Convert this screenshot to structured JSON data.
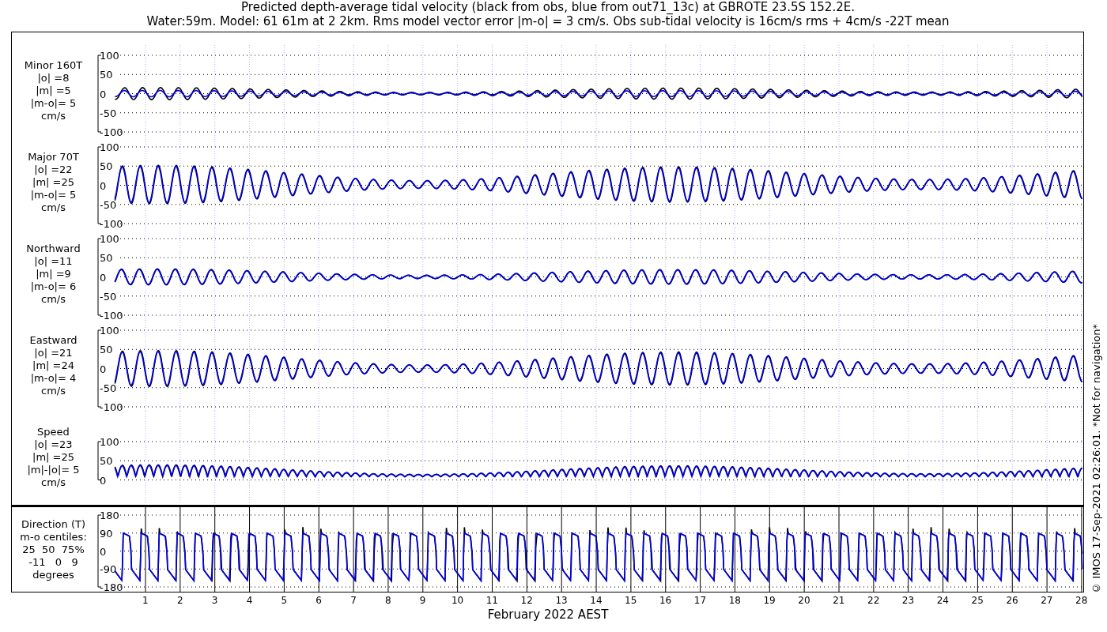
{
  "title_lines": [
    "Predicted depth-average tidal velocity (black from obs, blue from out71_13c) at GBROTE 23.5S 152.2E.",
    "Water:59m. Model: 61 61m at 2 2km. Rms model vector error |m-o| = 3 cm/s. Obs sub-tidal velocity is 16cm/s rms + 4cm/s -22T mean"
  ],
  "panels": [
    {
      "kind": "minor",
      "label_lines": [
        "Minor 160T",
        "|o| =8",
        "|m| =5",
        "|m-o|= 5",
        "cm/s"
      ],
      "yticks": [
        "100",
        "50",
        "0",
        "-50",
        "-100"
      ]
    },
    {
      "kind": "major",
      "label_lines": [
        "Major 70T",
        "|o| =22",
        "|m| =25",
        "|m-o|= 5",
        "cm/s"
      ],
      "yticks": [
        "100",
        "50",
        "0",
        "-50",
        "-100"
      ]
    },
    {
      "kind": "north",
      "label_lines": [
        "Northward",
        "|o| =11",
        "|m| =9",
        "|m-o|= 6",
        "cm/s"
      ],
      "yticks": [
        "100",
        "50",
        "0",
        "-50",
        "-100"
      ]
    },
    {
      "kind": "east",
      "label_lines": [
        "Eastward",
        "|o| =21",
        "|m| =24",
        "|m-o|= 4",
        "cm/s"
      ],
      "yticks": [
        "100",
        "50",
        "0",
        "-50",
        "-100"
      ]
    },
    {
      "kind": "speed",
      "label_lines": [
        "Speed",
        "|o| =23",
        "|m| =25",
        "|m|-|o|= 5",
        "cm/s"
      ],
      "yticks": [
        "100",
        "50",
        "0"
      ]
    }
  ],
  "direction_panel": {
    "kind": "direction",
    "label_lines": [
      "Direction (T)",
      "m-o centiles:",
      "25  50  75%",
      "-11   0   9",
      "degrees"
    ],
    "yticks": [
      "180",
      "90",
      "0",
      "-90",
      "-180"
    ]
  },
  "days": [
    "1",
    "2",
    "3",
    "4",
    "5",
    "6",
    "7",
    "8",
    "9",
    "10",
    "11",
    "12",
    "13",
    "14",
    "15",
    "16",
    "17",
    "18",
    "19",
    "20",
    "21",
    "22",
    "23",
    "24",
    "25",
    "26",
    "27",
    "28"
  ],
  "xlabel": "February 2022 AEST",
  "credit": "© IMOS 17-Sep-2021 02:26:01. *Not for navigation*"
}
